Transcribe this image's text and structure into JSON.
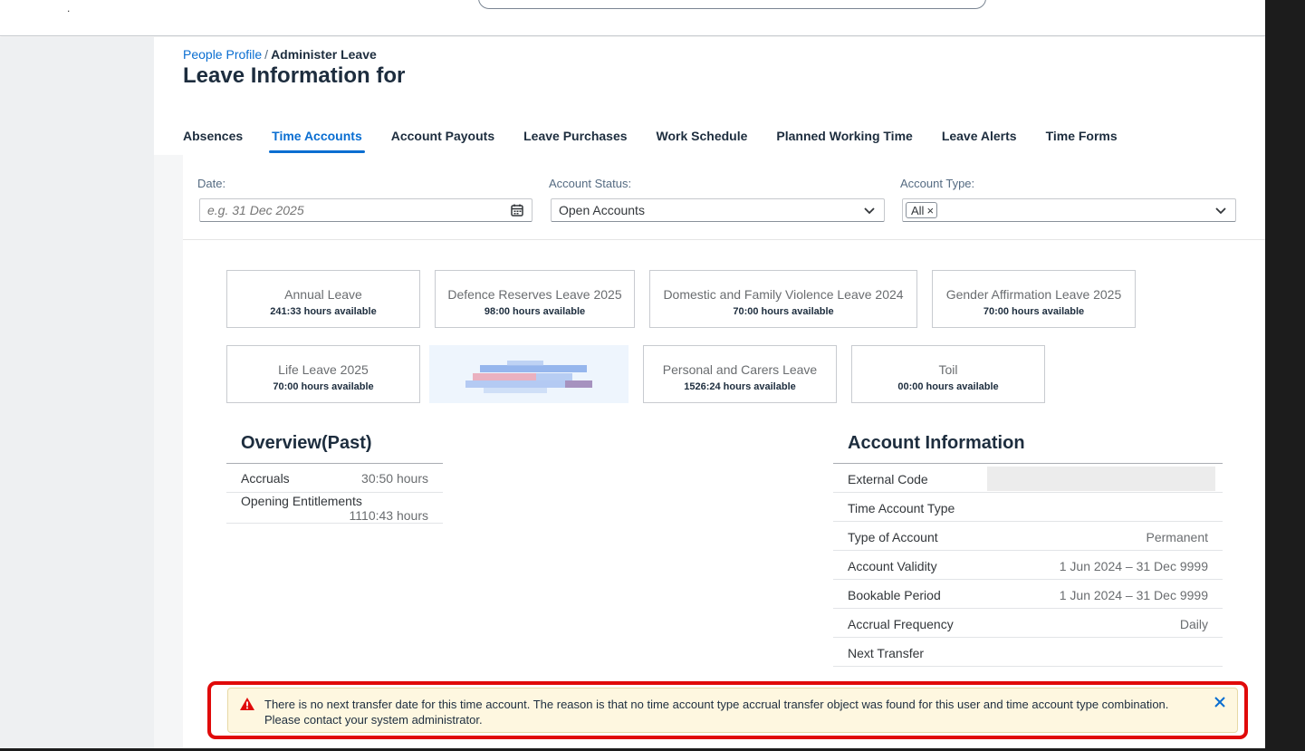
{
  "shell": {
    "dot": "."
  },
  "breadcrumb": {
    "link": "People Profile",
    "separator": "/",
    "current": "Administer Leave"
  },
  "page_title": "Leave Information for",
  "tabs": [
    {
      "label": "Absences",
      "active": false
    },
    {
      "label": "Time Accounts",
      "active": true
    },
    {
      "label": "Account Payouts",
      "active": false
    },
    {
      "label": "Leave Purchases",
      "active": false
    },
    {
      "label": "Work Schedule",
      "active": false
    },
    {
      "label": "Planned Working Time",
      "active": false
    },
    {
      "label": "Leave Alerts",
      "active": false
    },
    {
      "label": "Time Forms",
      "active": false
    }
  ],
  "filters": {
    "date": {
      "label": "Date:",
      "placeholder": "e.g. 31 Dec 2025",
      "icon": "calendar-icon"
    },
    "status": {
      "label": "Account Status:",
      "value": "Open Accounts",
      "icon": "chevron-down-icon"
    },
    "type": {
      "label": "Account Type:",
      "token": "All",
      "icon": "chevron-down-icon"
    }
  },
  "tiles": [
    {
      "name": "Annual Leave",
      "value": "241:33 hours available"
    },
    {
      "name": "Defence Reserves Leave 2025",
      "value": "98:00 hours available"
    },
    {
      "name": "Domestic and Family Violence Leave 2024",
      "value": "70:00 hours available"
    },
    {
      "name": "Gender Affirmation Leave 2025",
      "value": "70:00 hours available"
    },
    {
      "name": "Life Leave 2025",
      "value": "70:00 hours available"
    },
    {
      "name": "Personal and Carers Leave",
      "value": "1526:24 hours available"
    },
    {
      "name": "Toil",
      "value": "00:00 hours available"
    }
  ],
  "overview": {
    "title": "Overview(Past)",
    "rows": [
      {
        "key": "Accruals",
        "value": "30:50 hours"
      },
      {
        "key": "Opening Entitlements",
        "value": "1110:43 hours"
      }
    ]
  },
  "account_info": {
    "title": "Account Information",
    "rows": [
      {
        "key": "External Code",
        "value": ""
      },
      {
        "key": "Time Account Type",
        "value": ""
      },
      {
        "key": "Type of Account",
        "value": "Permanent"
      },
      {
        "key": "Account Validity",
        "value": "1 Jun 2024 – 31 Dec 9999"
      },
      {
        "key": "Bookable Period",
        "value": "1 Jun 2024 – 31 Dec 9999"
      },
      {
        "key": "Accrual Frequency",
        "value": "Daily"
      },
      {
        "key": "Next Transfer",
        "value": ""
      }
    ]
  },
  "alert": {
    "message": "There is no next transfer date for this time account. The reason is that no time account type accrual transfer object was found for this user and time account type combination. Please contact your system administrator.",
    "icon": "warning-icon",
    "close_icon": "close-icon",
    "colors": {
      "background": "#fef7e0",
      "icon": "#e00a0a",
      "highlight": "#e00a0a"
    }
  },
  "colors": {
    "accent": "#0a6ed1",
    "text": "#1d2d3e"
  }
}
